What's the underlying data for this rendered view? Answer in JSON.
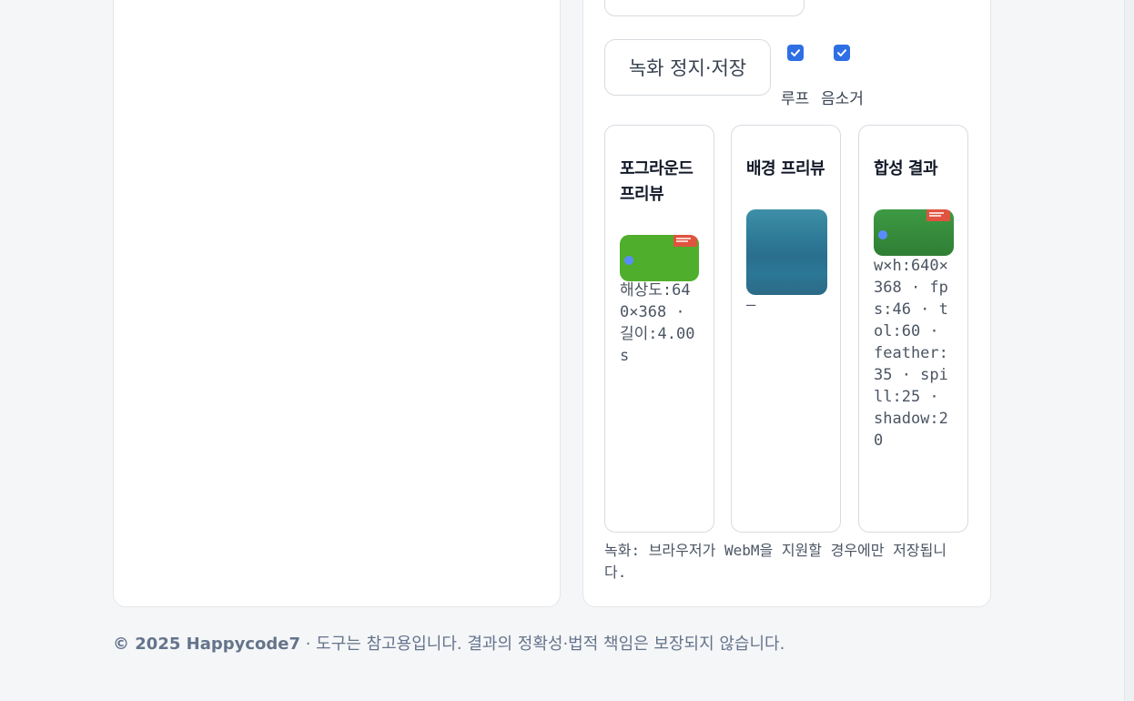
{
  "controls": {
    "stop_save_label": "녹화 정지·저장",
    "loop_label": "루프",
    "mute_label": "음소거",
    "loop_checked": true,
    "mute_checked": true
  },
  "panels": {
    "foreground": {
      "title": "포그라운드 프리뷰",
      "meta": "해상도:640×368 · 길이:4.00s"
    },
    "background": {
      "title": "배경 프리뷰",
      "meta": "–"
    },
    "result": {
      "title": "합성 결과",
      "meta": "w×h:640×368 · fps:46 · tol:60 · feather:35 · spill:25 · shadow:20"
    }
  },
  "note": "녹화: 브라우저가 WebM을 지원할 경우에만 저장됩니다.",
  "footer": {
    "brand": "© 2025 Happycode7",
    "text": " · 도구는 참고용입니다. 결과의 정확성·법적 책임은 보장되지 않습니다."
  },
  "colors": {
    "accent": "#2f6fe4",
    "fg_thumb": "#4fae2c",
    "dot": "#5b8cff",
    "flag": "#e0533f"
  }
}
